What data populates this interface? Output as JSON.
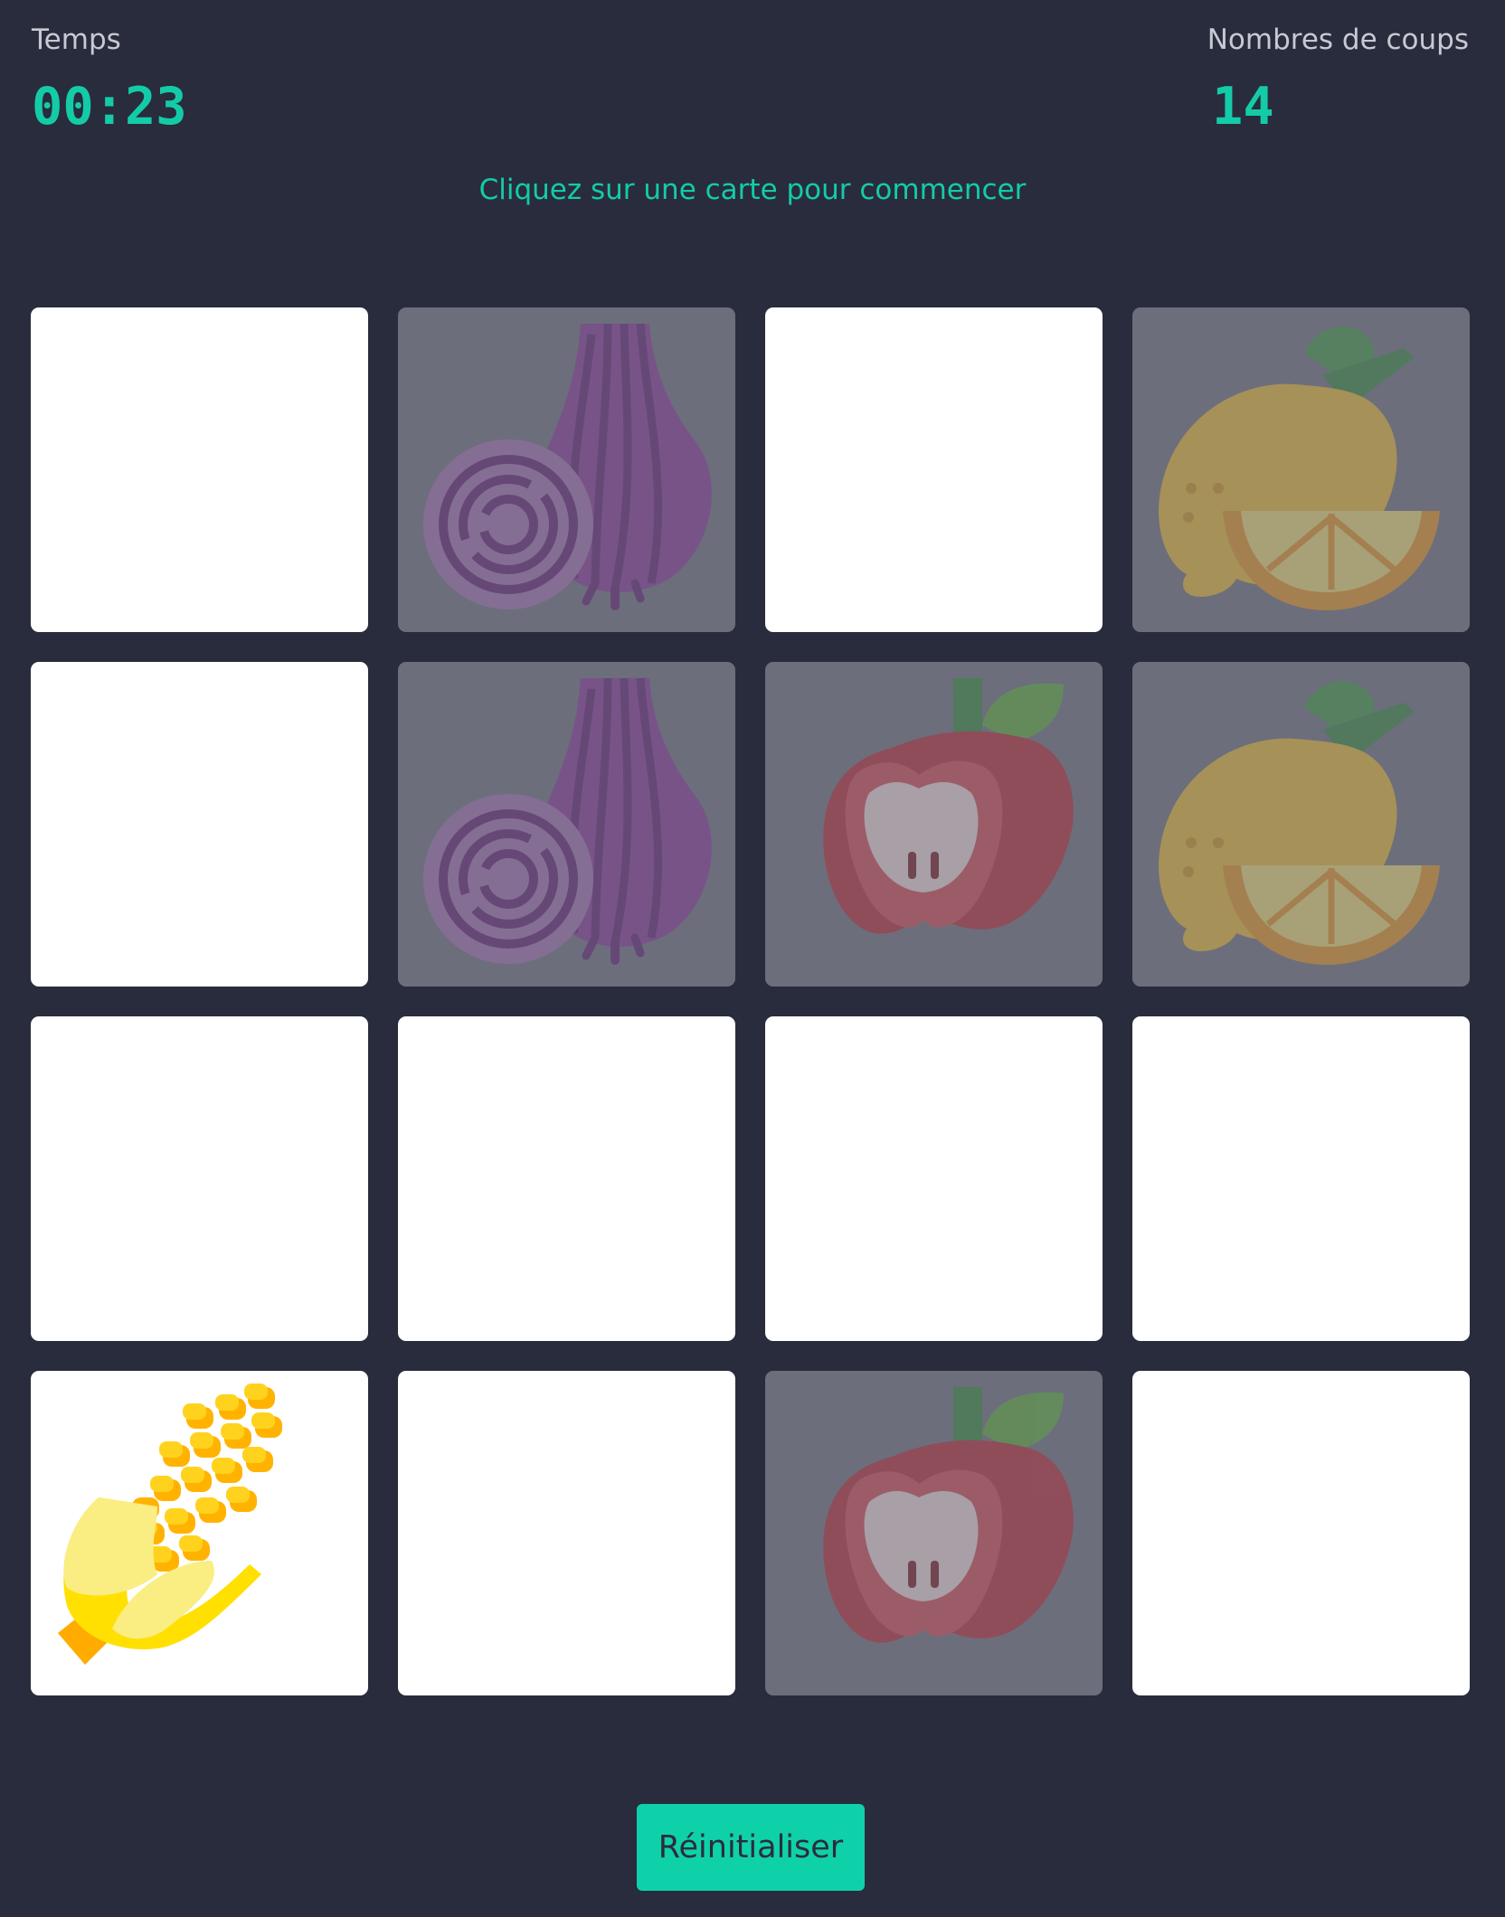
{
  "header": {
    "time_label": "Temps",
    "time_value": "00:23",
    "moves_label": "Nombres de coups",
    "moves_value": "14"
  },
  "status_message": "Cliquez sur une carte pour commencer",
  "reset_label": "Réinitialiser",
  "colors": {
    "background": "#292c3c",
    "accent": "#14cba8",
    "button": "#0fd1a9",
    "card_hidden": "#ffffff",
    "card_matched": "#6c6e7c"
  },
  "grid": {
    "columns": 4,
    "rows": 4,
    "cards": [
      {
        "state": "hidden",
        "icon": null
      },
      {
        "state": "matched",
        "icon": "onion-icon"
      },
      {
        "state": "hidden",
        "icon": null
      },
      {
        "state": "matched",
        "icon": "lemon-icon"
      },
      {
        "state": "hidden",
        "icon": null
      },
      {
        "state": "matched",
        "icon": "onion-icon"
      },
      {
        "state": "matched",
        "icon": "apple-icon"
      },
      {
        "state": "matched",
        "icon": "lemon-icon"
      },
      {
        "state": "hidden",
        "icon": null
      },
      {
        "state": "hidden",
        "icon": null
      },
      {
        "state": "hidden",
        "icon": null
      },
      {
        "state": "hidden",
        "icon": null
      },
      {
        "state": "revealed",
        "icon": "corn-icon"
      },
      {
        "state": "hidden",
        "icon": null
      },
      {
        "state": "matched",
        "icon": "apple-icon"
      },
      {
        "state": "hidden",
        "icon": null
      }
    ]
  }
}
